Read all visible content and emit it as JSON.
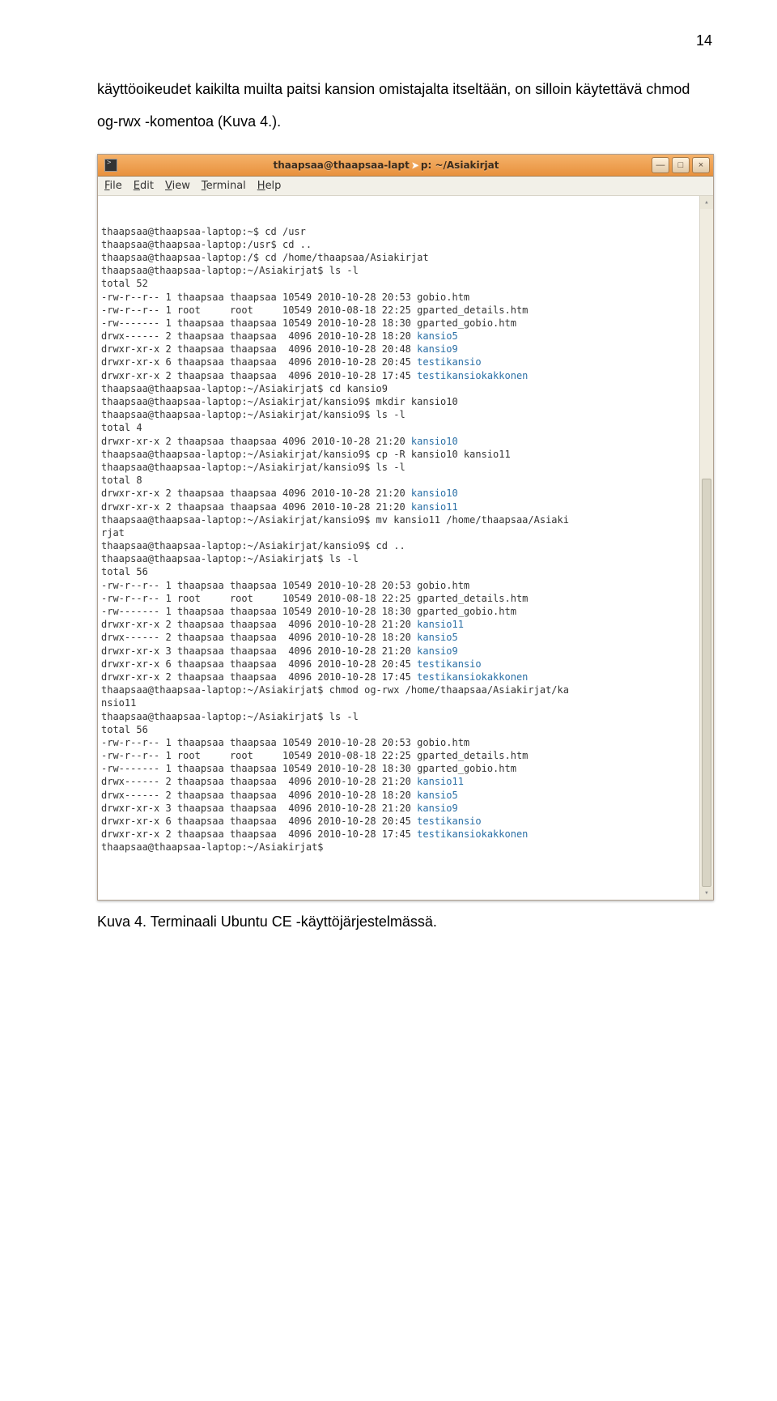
{
  "page_number": "14",
  "paragraph": "käyttöoikeudet kaikilta muilta paitsi kansion omistajalta itseltään, on silloin käytettävä chmod og-rwx -komentoa (Kuva 4.).",
  "caption": "Kuva 4. Terminaali Ubuntu CE -käyttöjärjestelmässä.",
  "window": {
    "title_prefix": "thaapsaa@thaapsaa-lapt",
    "title_suffix": "p: ~/Asiakirjat",
    "menu": {
      "file": "File",
      "edit": "Edit",
      "view": "View",
      "terminal": "Terminal",
      "help": "Help"
    },
    "btn_min": "—",
    "btn_max": "□",
    "btn_close": "×",
    "scroll_up": "▴",
    "scroll_down": "▾"
  },
  "terminal_lines": [
    {
      "t": "thaapsaa@thaapsaa-laptop:~$ cd /usr"
    },
    {
      "t": "thaapsaa@thaapsaa-laptop:/usr$ cd .."
    },
    {
      "t": "thaapsaa@thaapsaa-laptop:/$ cd /home/thaapsaa/Asiakirjat"
    },
    {
      "t": "thaapsaa@thaapsaa-laptop:~/Asiakirjat$ ls -l"
    },
    {
      "t": "total 52"
    },
    {
      "t": "-rw-r--r-- 1 thaapsaa thaapsaa 10549 2010-10-28 20:53 gobio.htm"
    },
    {
      "t": "-rw-r--r-- 1 root     root     10549 2010-08-18 22:25 gparted_details.htm"
    },
    {
      "t": "-rw------- 1 thaapsaa thaapsaa 10549 2010-10-28 18:30 gparted_gobio.htm"
    },
    {
      "t": "drwx------ 2 thaapsaa thaapsaa  4096 2010-10-28 18:20 ",
      "d": "kansio5"
    },
    {
      "t": "drwxr-xr-x 2 thaapsaa thaapsaa  4096 2010-10-28 20:48 ",
      "d": "kansio9"
    },
    {
      "t": "drwxr-xr-x 6 thaapsaa thaapsaa  4096 2010-10-28 20:45 ",
      "d": "testikansio"
    },
    {
      "t": "drwxr-xr-x 2 thaapsaa thaapsaa  4096 2010-10-28 17:45 ",
      "d": "testikansiokakkonen"
    },
    {
      "t": "thaapsaa@thaapsaa-laptop:~/Asiakirjat$ cd kansio9"
    },
    {
      "t": "thaapsaa@thaapsaa-laptop:~/Asiakirjat/kansio9$ mkdir kansio10"
    },
    {
      "t": "thaapsaa@thaapsaa-laptop:~/Asiakirjat/kansio9$ ls -l"
    },
    {
      "t": "total 4"
    },
    {
      "t": "drwxr-xr-x 2 thaapsaa thaapsaa 4096 2010-10-28 21:20 ",
      "d": "kansio10"
    },
    {
      "t": "thaapsaa@thaapsaa-laptop:~/Asiakirjat/kansio9$ cp -R kansio10 kansio11"
    },
    {
      "t": "thaapsaa@thaapsaa-laptop:~/Asiakirjat/kansio9$ ls -l"
    },
    {
      "t": "total 8"
    },
    {
      "t": "drwxr-xr-x 2 thaapsaa thaapsaa 4096 2010-10-28 21:20 ",
      "d": "kansio10"
    },
    {
      "t": "drwxr-xr-x 2 thaapsaa thaapsaa 4096 2010-10-28 21:20 ",
      "d": "kansio11"
    },
    {
      "t": "thaapsaa@thaapsaa-laptop:~/Asiakirjat/kansio9$ mv kansio11 /home/thaapsaa/Asiaki"
    },
    {
      "t": "rjat"
    },
    {
      "t": "thaapsaa@thaapsaa-laptop:~/Asiakirjat/kansio9$ cd .."
    },
    {
      "t": "thaapsaa@thaapsaa-laptop:~/Asiakirjat$ ls -l"
    },
    {
      "t": "total 56"
    },
    {
      "t": "-rw-r--r-- 1 thaapsaa thaapsaa 10549 2010-10-28 20:53 gobio.htm"
    },
    {
      "t": "-rw-r--r-- 1 root     root     10549 2010-08-18 22:25 gparted_details.htm"
    },
    {
      "t": "-rw------- 1 thaapsaa thaapsaa 10549 2010-10-28 18:30 gparted_gobio.htm"
    },
    {
      "t": "drwxr-xr-x 2 thaapsaa thaapsaa  4096 2010-10-28 21:20 ",
      "d": "kansio11"
    },
    {
      "t": "drwx------ 2 thaapsaa thaapsaa  4096 2010-10-28 18:20 ",
      "d": "kansio5"
    },
    {
      "t": "drwxr-xr-x 3 thaapsaa thaapsaa  4096 2010-10-28 21:20 ",
      "d": "kansio9"
    },
    {
      "t": "drwxr-xr-x 6 thaapsaa thaapsaa  4096 2010-10-28 20:45 ",
      "d": "testikansio"
    },
    {
      "t": "drwxr-xr-x 2 thaapsaa thaapsaa  4096 2010-10-28 17:45 ",
      "d": "testikansiokakkonen"
    },
    {
      "t": "thaapsaa@thaapsaa-laptop:~/Asiakirjat$ chmod og-rwx /home/thaapsaa/Asiakirjat/ka"
    },
    {
      "t": "nsio11"
    },
    {
      "t": "thaapsaa@thaapsaa-laptop:~/Asiakirjat$ ls -l"
    },
    {
      "t": "total 56"
    },
    {
      "t": "-rw-r--r-- 1 thaapsaa thaapsaa 10549 2010-10-28 20:53 gobio.htm"
    },
    {
      "t": "-rw-r--r-- 1 root     root     10549 2010-08-18 22:25 gparted_details.htm"
    },
    {
      "t": "-rw------- 1 thaapsaa thaapsaa 10549 2010-10-28 18:30 gparted_gobio.htm"
    },
    {
      "t": "drwx------ 2 thaapsaa thaapsaa  4096 2010-10-28 21:20 ",
      "d": "kansio11"
    },
    {
      "t": "drwx------ 2 thaapsaa thaapsaa  4096 2010-10-28 18:20 ",
      "d": "kansio5"
    },
    {
      "t": "drwxr-xr-x 3 thaapsaa thaapsaa  4096 2010-10-28 21:20 ",
      "d": "kansio9"
    },
    {
      "t": "drwxr-xr-x 6 thaapsaa thaapsaa  4096 2010-10-28 20:45 ",
      "d": "testikansio"
    },
    {
      "t": "drwxr-xr-x 2 thaapsaa thaapsaa  4096 2010-10-28 17:45 ",
      "d": "testikansiokakkonen"
    },
    {
      "t": "thaapsaa@thaapsaa-laptop:~/Asiakirjat$"
    }
  ]
}
